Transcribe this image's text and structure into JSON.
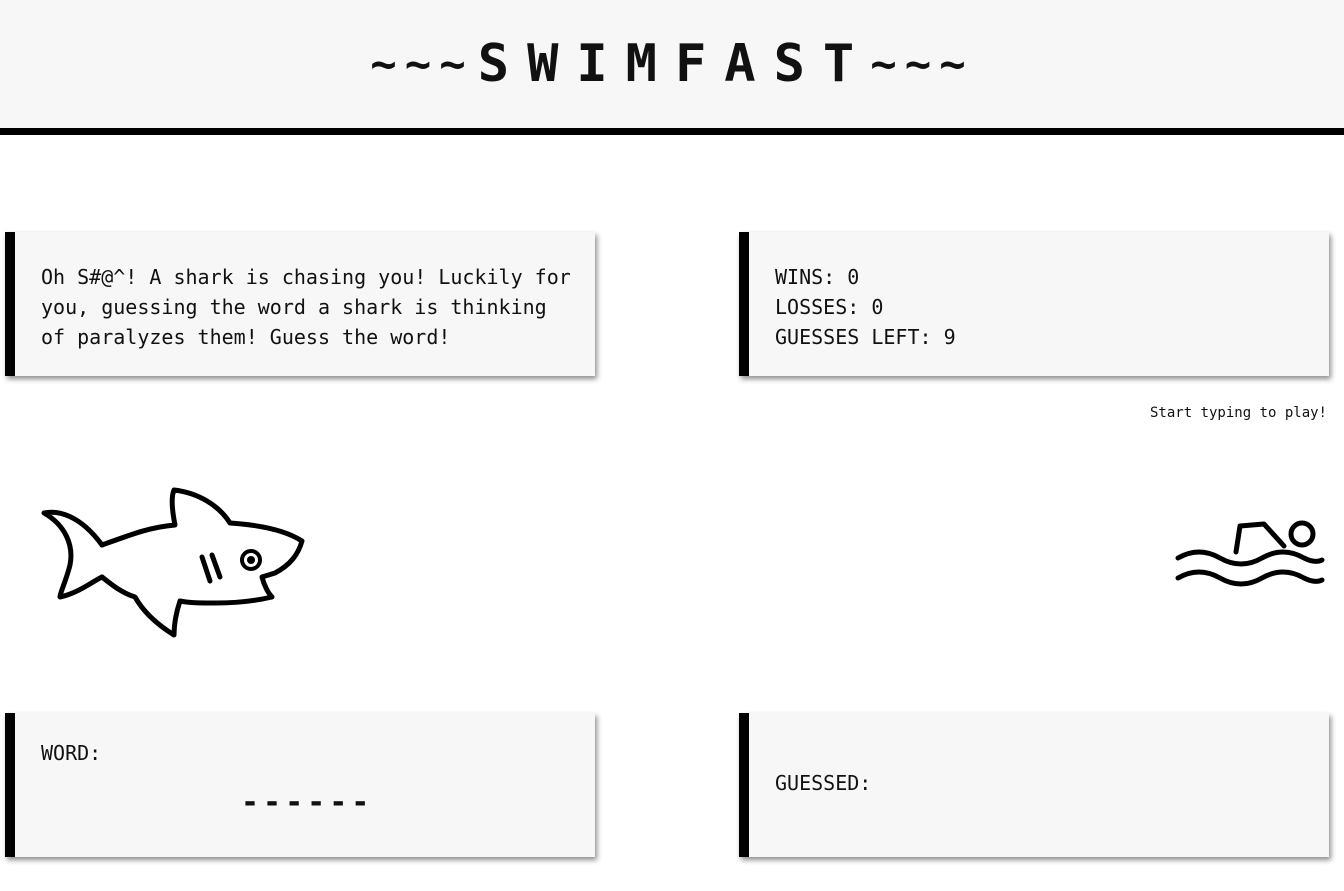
{
  "header": {
    "wave_left": "~~~",
    "title": "SWIMFAST",
    "wave_right": "~~~"
  },
  "intro": {
    "text": "Oh S#@^! A shark is chasing you! Luckily for you, guessing the word a shark is thinking of paralyzes them! Guess the word!"
  },
  "stats": {
    "wins": "WINS: 0",
    "losses": "LOSSES: 0",
    "guesses_left": "GUESSES LEFT: 9"
  },
  "hint": "Start typing to play!",
  "word": {
    "label": "WORD:",
    "blanks": "------"
  },
  "guessed": {
    "label": "GUESSED:",
    "letters": ""
  },
  "icons": {
    "shark": "shark-icon",
    "swimmer": "swimmer-icon"
  }
}
